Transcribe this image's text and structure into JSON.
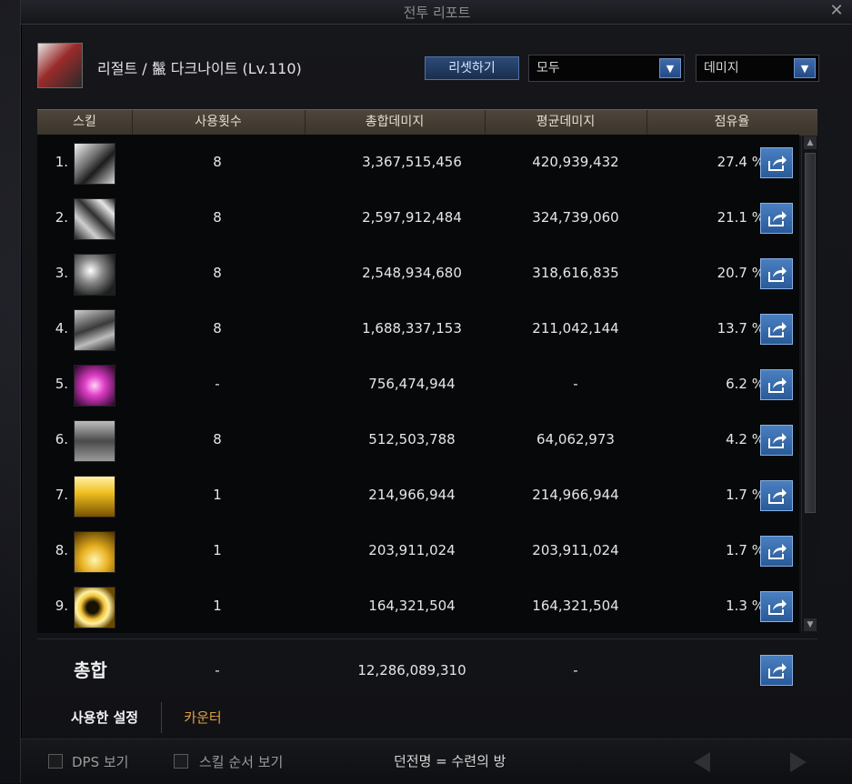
{
  "window": {
    "title": "전투 리포트",
    "character": "리절트 / 鬣 다크나이트 (Lv.110)"
  },
  "controls": {
    "reset_label": "리셋하기",
    "filter_value": "모두",
    "metric_value": "데미지"
  },
  "table": {
    "headers": [
      "스킬",
      "사용횟수",
      "총합데미지",
      "평균데미지",
      "점유율"
    ],
    "rows": [
      {
        "rank": "1.",
        "icon": "slash-skill-icon",
        "count": "8",
        "total": "3,367,515,456",
        "avg": "420,939,432",
        "share": "27.4 %"
      },
      {
        "rank": "2.",
        "icon": "cross-slash-skill-icon",
        "count": "8",
        "total": "2,597,912,484",
        "avg": "324,739,060",
        "share": "21.1 %"
      },
      {
        "rank": "3.",
        "icon": "burst-skill-icon",
        "count": "8",
        "total": "2,548,934,680",
        "avg": "318,616,835",
        "share": "20.7 %"
      },
      {
        "rank": "4.",
        "icon": "beast-skill-icon",
        "count": "8",
        "total": "1,688,337,153",
        "avg": "211,042,144",
        "share": "13.7 %"
      },
      {
        "rank": "5.",
        "icon": "pink-orb-skill-icon",
        "count": "-",
        "total": "756,474,944",
        "avg": "-",
        "share": "6.2 %"
      },
      {
        "rank": "6.",
        "icon": "crown-skill-icon",
        "count": "8",
        "total": "512,503,788",
        "avg": "64,062,973",
        "share": "4.2 %"
      },
      {
        "rank": "7.",
        "icon": "gold-claw-skill-icon",
        "count": "1",
        "total": "214,966,944",
        "avg": "214,966,944",
        "share": "1.7 %"
      },
      {
        "rank": "8.",
        "icon": "gold-spire-skill-icon",
        "count": "1",
        "total": "203,911,024",
        "avg": "203,911,024",
        "share": "1.7 %"
      },
      {
        "rank": "9.",
        "icon": "gold-ring-skill-icon",
        "count": "1",
        "total": "164,321,504",
        "avg": "164,321,504",
        "share": "1.3 %"
      }
    ]
  },
  "summary": {
    "label": "총합",
    "count": "-",
    "total": "12,286,089,310",
    "avg": "-"
  },
  "tabs": {
    "used": "사용한 설정",
    "counter": "카운터"
  },
  "footer": {
    "dps_label": "DPS 보기",
    "order_label": "스킬 순서 보기",
    "dungeon": "던전명 = 수련의 방"
  },
  "colors": {
    "accent_blue": "#2f66ad",
    "header_brown": "#4e463b",
    "counter_orange": "#e0a040"
  }
}
